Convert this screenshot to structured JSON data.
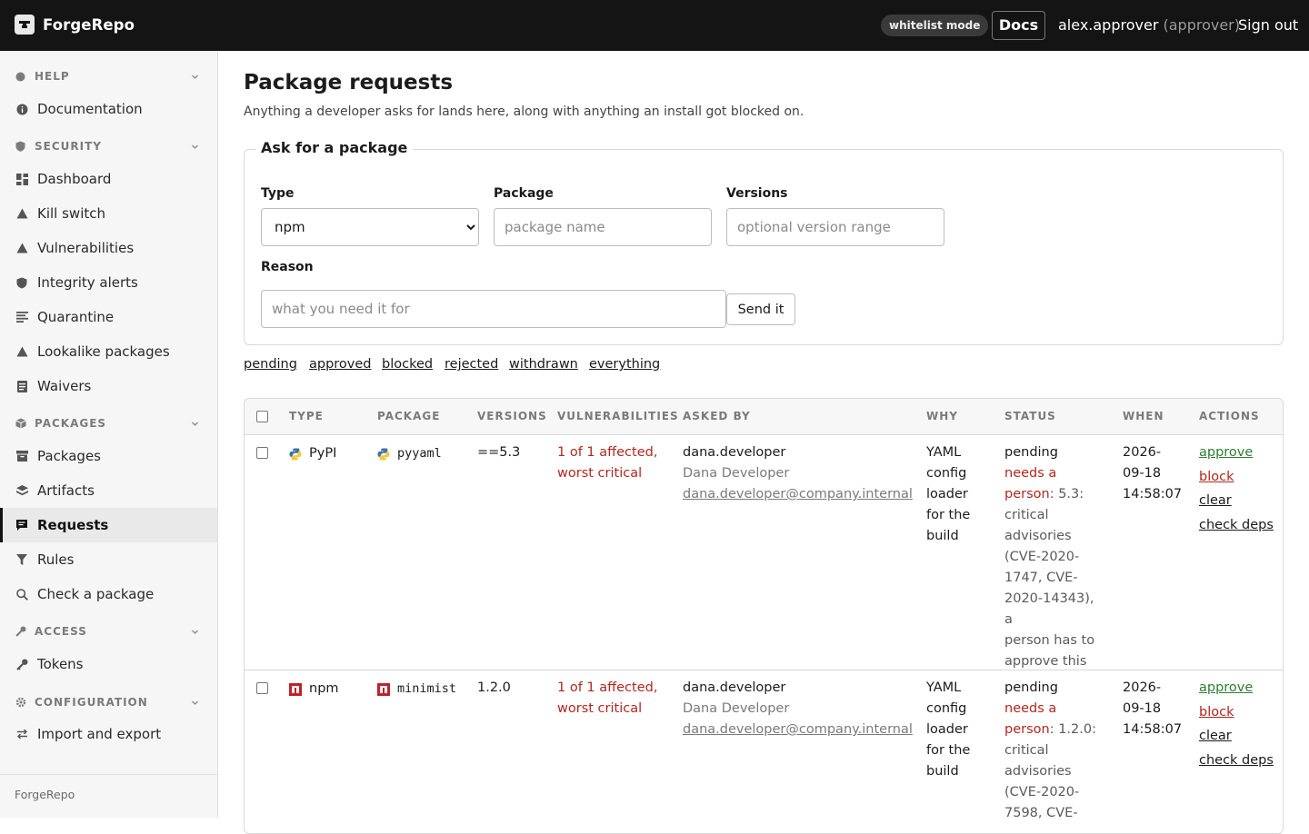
{
  "header": {
    "brand": "ForgeRepo",
    "mode_badge": "whitelist mode",
    "docs_label": "Docs",
    "user_name": "alex.approver",
    "user_role": "(approver)",
    "signout_label": "Sign out"
  },
  "sidebar": {
    "sections": {
      "help": "HELP",
      "security": "SECURITY",
      "packages": "PACKAGES",
      "access": "ACCESS",
      "configuration": "CONFIGURATION"
    },
    "items": {
      "documentation": "Documentation",
      "dashboard": "Dashboard",
      "kill_switch": "Kill switch",
      "vulnerabilities": "Vulnerabilities",
      "integrity_alerts": "Integrity alerts",
      "quarantine": "Quarantine",
      "lookalike": "Lookalike packages",
      "waivers": "Waivers",
      "packages": "Packages",
      "artifacts": "Artifacts",
      "requests": "Requests",
      "rules": "Rules",
      "check": "Check a package",
      "tokens": "Tokens",
      "import_export": "Import and export"
    },
    "active": "requests",
    "footer": "ForgeRepo"
  },
  "page": {
    "title": "Package requests",
    "subtitle": "Anything a developer asks for lands here, along with anything an install got blocked on."
  },
  "ask_form": {
    "title": "Ask for a package",
    "type_label": "Type",
    "type_value": "npm",
    "package_label": "Package",
    "package_placeholder": "package name",
    "versions_label": "Versions",
    "versions_placeholder": "optional version range",
    "reason_label": "Reason",
    "reason_placeholder": "what you need it for",
    "send_label": "Send it"
  },
  "filters": [
    "pending",
    "approved",
    "blocked",
    "rejected",
    "withdrawn",
    "everything"
  ],
  "table": {
    "headers": {
      "type": "TYPE",
      "package": "PACKAGE",
      "versions": "VERSIONS",
      "vulnerabilities": "VULNERABILITIES",
      "asked_by": "ASKED BY",
      "why": "WHY",
      "status": "STATUS",
      "when": "WHEN",
      "actions": "ACTIONS"
    },
    "rows": [
      {
        "type": "PyPI",
        "type_icon": "python-icon",
        "package": "pyyaml",
        "versions": "==5.3",
        "vuln_line1": "1 of 1 affected,",
        "vuln_line2": "worst critical",
        "asked_user": "dana.developer",
        "asked_name": "Dana Developer",
        "asked_email": "dana.developer@company.internal",
        "why": [
          "YAML",
          "config",
          "loader",
          "for the",
          "build"
        ],
        "status": "pending",
        "status_need": [
          "needs a",
          "person"
        ],
        "status_detail": [
          ": 5.3:",
          "critical",
          "advisories",
          "(CVE-2020-",
          "1747, CVE-",
          "2020-14343), a",
          "person has to",
          "approve this"
        ],
        "when": [
          "2026-",
          "09-18",
          "14:58:07"
        ],
        "actions": {
          "approve": "approve",
          "block": "block",
          "clear": "clear",
          "check": "check deps"
        }
      },
      {
        "type": "npm",
        "type_icon": "npm-icon",
        "package": "minimist",
        "versions": "1.2.0",
        "vuln_line1": "1 of 1 affected,",
        "vuln_line2": "worst critical",
        "asked_user": "dana.developer",
        "asked_name": "Dana Developer",
        "asked_email": "dana.developer@company.internal",
        "why": [
          "YAML",
          "config",
          "loader",
          "for the",
          "build"
        ],
        "status": "pending",
        "status_need": [
          "needs a",
          "person"
        ],
        "status_detail": [
          ": 1.2.0:",
          "critical",
          "advisories",
          "(CVE-2020-",
          "7598, CVE-"
        ],
        "when": [
          "2026-",
          "09-18",
          "14:58:07"
        ],
        "actions": {
          "approve": "approve",
          "block": "block",
          "clear": "clear",
          "check": "check deps"
        }
      }
    ]
  },
  "colors": {
    "topbar": "#141414",
    "danger": "#b3261e",
    "success": "#2e7d32",
    "sidebar_bg": "#f6f6f6"
  }
}
